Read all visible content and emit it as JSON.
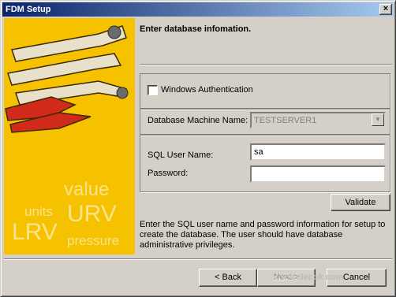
{
  "window": {
    "title": "FDM Setup",
    "close_glyph": "×"
  },
  "sidebar": {
    "words": [
      "value",
      "units",
      "URV",
      "LRV",
      "pressure"
    ],
    "colors": {
      "background": "#f6c200",
      "text": "#fbe38a"
    },
    "image": "tools-illustration"
  },
  "heading": "Enter database infomation.",
  "auth": {
    "windows_label": "Windows Authentication",
    "checked": false
  },
  "db": {
    "machine_label": "Database Machine Name:",
    "machine_value": "TESTSERVER1"
  },
  "sql": {
    "user_label": "SQL User Name:",
    "user_value": "sa",
    "password_label": "Password:",
    "password_value": ""
  },
  "buttons": {
    "validate": "Validate",
    "back": "< Back",
    "next": "Next >",
    "cancel": "Cancel"
  },
  "info_text": "Enter the SQL user name and password information for setup to create the database. The user should have database administrative privileges.",
  "watermark": "www.elecok.com"
}
